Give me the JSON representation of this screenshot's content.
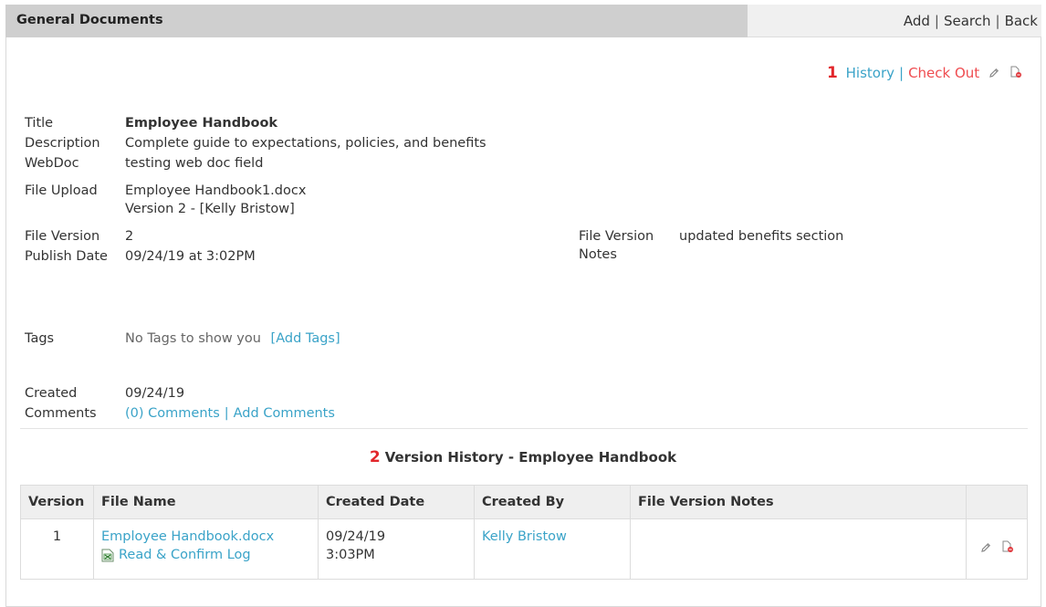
{
  "header": {
    "title": "General Documents",
    "links": [
      "Add",
      "Search",
      "Back"
    ]
  },
  "top_actions": {
    "number": "1",
    "history": "History",
    "check_out": "Check Out"
  },
  "doc": {
    "title_label": "Title",
    "title": "Employee Handbook",
    "description_label": "Description",
    "description": "Complete guide to expectations, policies, and benefits",
    "webdoc_label": "WebDoc",
    "webdoc": "testing web doc field",
    "file_upload_label": "File Upload",
    "file_upload_name": "Employee Handbook1.docx",
    "file_upload_version": "Version 2 - [Kelly Bristow]",
    "file_version_label": "File Version",
    "file_version": "2",
    "publish_date_label": "Publish Date",
    "publish_date": "09/24/19 at 3:02PM",
    "fv_notes_label_1": "File Version",
    "fv_notes_label_2": "Notes",
    "fv_notes": "updated benefits section",
    "tags_label": "Tags",
    "tags_empty": "No Tags to show you",
    "add_tags": "[Add Tags]",
    "created_label": "Created",
    "created": "09/24/19",
    "comments_label": "Comments",
    "comments_link": "(0) Comments",
    "add_comments": "Add Comments"
  },
  "version_history": {
    "number": "2",
    "title": "Version History - Employee Handbook",
    "columns": [
      "Version",
      "File Name",
      "Created Date",
      "Created By",
      "File Version Notes",
      ""
    ],
    "rows": [
      {
        "version": "1",
        "file_name": "Employee Handbook.docx",
        "log_link": "Read & Confirm Log",
        "created_date_1": "09/24/19",
        "created_date_2": "3:03PM",
        "created_by": "Kelly Bristow",
        "notes": ""
      }
    ]
  }
}
